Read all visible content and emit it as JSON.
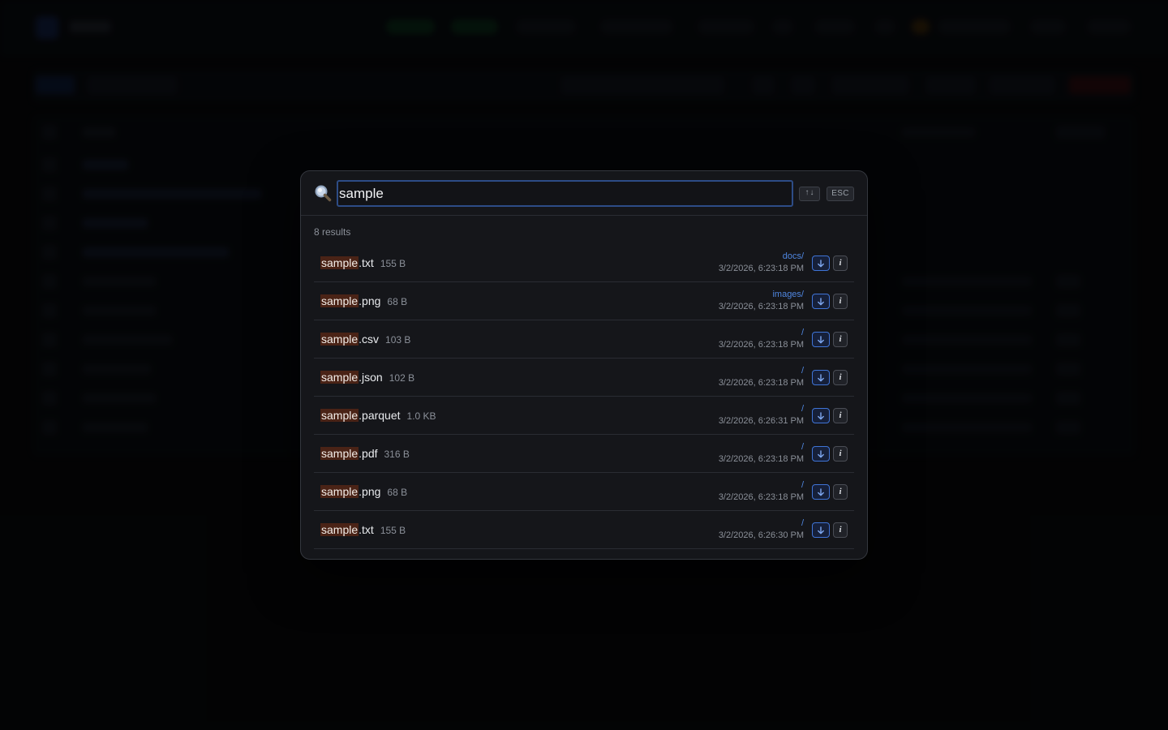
{
  "search": {
    "query": "sample",
    "sort_key": "↑↓",
    "esc_key": "ESC"
  },
  "results": {
    "count_label": "8 results",
    "items": [
      {
        "highlight": "sample",
        "rest": ".txt",
        "size": "155 B",
        "path": "docs/",
        "date": "3/2/2026, 6:23:18 PM"
      },
      {
        "highlight": "sample",
        "rest": ".png",
        "size": "68 B",
        "path": "images/",
        "date": "3/2/2026, 6:23:18 PM"
      },
      {
        "highlight": "sample",
        "rest": ".csv",
        "size": "103 B",
        "path": "/",
        "date": "3/2/2026, 6:23:18 PM"
      },
      {
        "highlight": "sample",
        "rest": ".json",
        "size": "102 B",
        "path": "/",
        "date": "3/2/2026, 6:23:18 PM"
      },
      {
        "highlight": "sample",
        "rest": ".parquet",
        "size": "1.0 KB",
        "path": "/",
        "date": "3/2/2026, 6:26:31 PM"
      },
      {
        "highlight": "sample",
        "rest": ".pdf",
        "size": "316 B",
        "path": "/",
        "date": "3/2/2026, 6:23:18 PM"
      },
      {
        "highlight": "sample",
        "rest": ".png",
        "size": "68 B",
        "path": "/",
        "date": "3/2/2026, 6:23:18 PM"
      },
      {
        "highlight": "sample",
        "rest": ".txt",
        "size": "155 B",
        "path": "/",
        "date": "3/2/2026, 6:26:30 PM"
      }
    ]
  },
  "icons": {
    "search": "search-icon",
    "download": "download-icon",
    "info": "info-icon"
  },
  "colors": {
    "accent": "#4f86e0",
    "highlight_bg": "#4a2316",
    "modal_bg": "#15161a"
  }
}
